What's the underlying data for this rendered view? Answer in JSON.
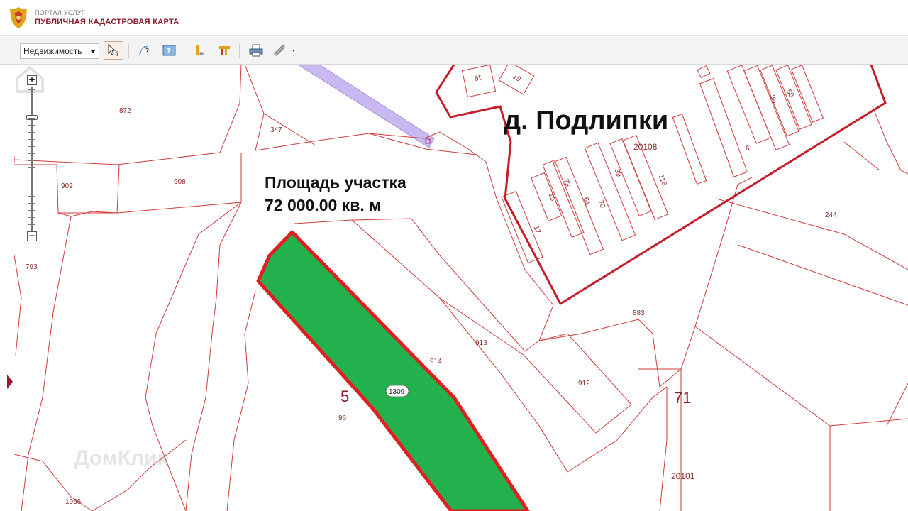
{
  "header": {
    "portal_label": "ПОРТАЛ УСЛУГ",
    "map_title": "ПУБЛИЧНАЯ КАДАСТРОВАЯ КАРТА"
  },
  "toolbar": {
    "layer_select_value": "Недвижимость",
    "buttons": [
      {
        "name": "select-info",
        "icon": "cursor-question-icon",
        "active": true
      },
      {
        "name": "measure-distance",
        "icon": "ruler-question-icon"
      },
      {
        "name": "identify",
        "icon": "help-box-icon"
      },
      {
        "name": "legend",
        "icon": "layers-icon"
      },
      {
        "name": "measure",
        "icon": "measure-icon"
      },
      {
        "name": "print",
        "icon": "printer-icon"
      },
      {
        "name": "link",
        "icon": "link-icon"
      }
    ]
  },
  "map": {
    "area_caption_line1": "Площадь участка",
    "area_caption_line2": "72 000.00 кв. м",
    "village_label": "д. Подлипки",
    "parcel_labels": [
      "872",
      "909",
      "908",
      "347",
      "793",
      "55",
      "19",
      "38",
      "50",
      "20108",
      "6",
      "15",
      "73",
      "61",
      "70",
      "39",
      "116",
      "17",
      "244",
      "883",
      "913",
      "914",
      "912",
      "1309",
      "96",
      "1956",
      "20101"
    ],
    "quarter_labels": [
      "5",
      "71"
    ],
    "selected_parcel": "1309",
    "selected_parcel_area": "72 000.00 кв. м",
    "watermark": "ДомКлик",
    "colors": {
      "parcel_outline": "#d03a3a",
      "selected_fill": "#23b14d",
      "selected_outline": "#e02020",
      "quarter_outline": "#c41e2a",
      "highlight_strip": "#c9b8f2"
    }
  },
  "zoom": {
    "plus": "+",
    "minus": "−"
  }
}
